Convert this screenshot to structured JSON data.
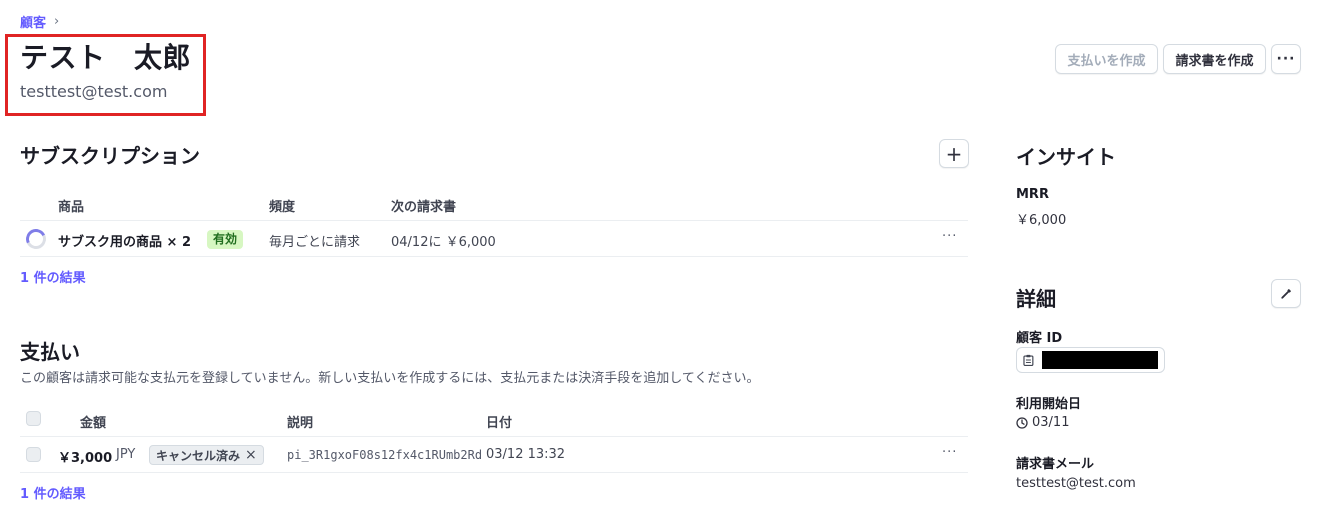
{
  "breadcrumb": {
    "label": "顧客",
    "chevron": "›"
  },
  "customer": {
    "name": "テスト　太郎",
    "email": "testtest@test.com"
  },
  "header_actions": {
    "create_payment": "支払いを作成",
    "create_invoice": "請求書を作成",
    "more": "···"
  },
  "subscriptions": {
    "title": "サブスクリプション",
    "add": "+",
    "columns": [
      "商品",
      "頻度",
      "次の請求書"
    ],
    "rows": [
      {
        "product": "サブスク用の商品 × 2",
        "status": "有効",
        "frequency": "毎月ごとに請求",
        "next_invoice": "04/12に ￥6,000",
        "more": "···"
      }
    ],
    "results": "1 件の結果"
  },
  "payments": {
    "title": "支払い",
    "description": "この顧客は請求可能な支払元を登録していません。新しい支払いを作成するには、支払元または決済手段を追加してください。",
    "columns": [
      "金額",
      "説明",
      "日付"
    ],
    "rows": [
      {
        "amount": "￥3,000",
        "currency": "JPY",
        "status": "キャンセル済み",
        "status_icon": "×",
        "description": "pi_3R1gxoF08s12fx4c1RUmb2Rd",
        "date": "03/12 13:32",
        "more": "···"
      }
    ],
    "results": "1 件の結果"
  },
  "insights": {
    "title": "インサイト",
    "mrr_label": "MRR",
    "mrr_value": "￥6,000"
  },
  "details": {
    "title": "詳細",
    "customer_id_label": "顧客 ID",
    "start_date_label": "利用開始日",
    "start_date_value": "03/11",
    "invoice_email_label": "請求書メール",
    "invoice_email_value": "testtest@test.com"
  },
  "colors": {
    "accent": "#635bff",
    "highlight_border": "#e02424",
    "active_badge_bg": "#d7f7c2"
  }
}
